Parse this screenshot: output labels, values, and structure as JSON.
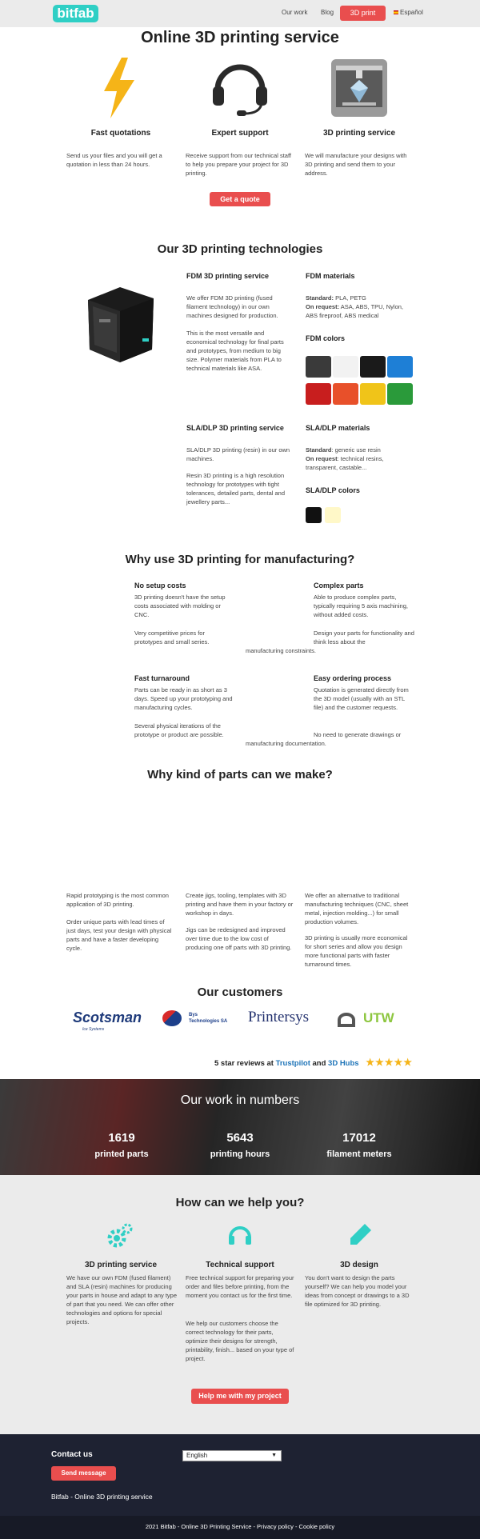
{
  "header": {
    "logo": "bitfab",
    "nav": [
      "Our work",
      "Blog"
    ],
    "cta": "3D print",
    "language": "Español"
  },
  "hero": {
    "title": "Online 3D printing service",
    "features": [
      {
        "title": "Fast quotations",
        "text": "Send us your files and you will get a quotation in less than 24 hours."
      },
      {
        "title": "Expert support",
        "text": "Receive support from our technical staff to help you prepare your project for 3D printing."
      },
      {
        "title": "3D printing service",
        "text": "We will manufacture your designs with 3D printing and send them to your address."
      }
    ],
    "cta": "Get a quote"
  },
  "tech": {
    "title": "Our 3D printing technologies",
    "fdm": {
      "title": "FDM 3D printing service",
      "p1": "We offer FDM 3D printing (fused filament technology) in our own machines designed for production.",
      "p2": "This is the most versatile and economical technology for final parts and prototypes, from medium to big size. Polymer materials from PLA to technical materials like ASA.",
      "materials_title": "FDM materials",
      "standard_label": "Standard:",
      "standard": "PLA, PETG",
      "request_label": "On request:",
      "request": "ASA, ABS, TPU, Nylon, ABS fireproof, ABS medical",
      "colors_title": "FDM colors",
      "colors": [
        "#3a3a3a",
        "#f2f2f2",
        "#1a1a1a",
        "#1e7fd6",
        "#c81e1e",
        "#e8502a",
        "#f0c419",
        "#2a9a3a"
      ]
    },
    "sla": {
      "title": "SLA/DLP 3D printing service",
      "p1": "SLA/DLP 3D printing (resin) in our own machines.",
      "p2": "Resin 3D printing is a high resolution technology for prototypes with tight tolerances, detailed parts, dental and jewellery parts...",
      "materials_title": "SLA/DLP materials",
      "standard_label": "Standard",
      "standard": ": generic use resin",
      "request_label": "On request",
      "request": ": technical resins, transparent, castable...",
      "colors_title": "SLA/DLP colors",
      "colors": [
        "#111111",
        "#fff8c8"
      ]
    }
  },
  "why": {
    "title": "Why use 3D printing for manufacturing?",
    "items": [
      {
        "title": "No setup costs",
        "p1": "3D printing doesn't have the setup costs associated with molding or CNC.",
        "p2": "Very competitive prices for prototypes and small series."
      },
      {
        "title": "Complex parts",
        "p1": "Able to produce complex parts, typically requiring 5 axis machining, without added costs.",
        "p2": "Design your parts for functionality and think less about the",
        "p3": "manufacturing constraints."
      },
      {
        "title": "Fast turnaround",
        "p1": "Parts can be ready in as short as 3 days. Speed up your prototyping and manufacturing cycles.",
        "p2": "Several physical iterations of the prototype or product are possible."
      },
      {
        "title": "Easy ordering process",
        "p1": "Quotation is generated directly from the 3D model (usually with an STL file) and the customer requests.",
        "p2": "No need to generate drawings or",
        "p3": "manufacturing documentation."
      }
    ]
  },
  "parts": {
    "title": "Why kind of parts can we make?",
    "cols": [
      {
        "p1": "Rapid prototyping is the most common application of 3D printing.",
        "p2": "Order unique parts with lead times of just days, test your design with physical parts and have a faster developing cycle."
      },
      {
        "p1": "Create jigs, tooling, templates with 3D printing and have them in your factory or workshop in days.",
        "p2": "Jigs can be redesigned and improved over time due to the low cost of producing one off parts with 3D printing."
      },
      {
        "p1": "We offer an alternative to traditional manufacturing techniques (CNC, sheet metal, injection molding...) for small production volumes.",
        "p2": "3D printing is usually more economical for short series and allow you design more functional parts with faster turnaround times."
      }
    ]
  },
  "customers": {
    "title": "Our customers",
    "logos": [
      "Scotsman",
      "Ice Systems",
      "Bys",
      "Technologies SA",
      "Printersys",
      "UTW"
    ],
    "reviews_prefix": "5 star reviews at",
    "trustpilot": "Trustpilot",
    "and": "and",
    "hubs": "3D Hubs",
    "stars": "★★★★★"
  },
  "numbers": {
    "title": "Our work in numbers",
    "items": [
      {
        "value": "1619",
        "label": "printed parts"
      },
      {
        "value": "5643",
        "label": "printing hours"
      },
      {
        "value": "17012",
        "label": "filament meters"
      }
    ]
  },
  "help": {
    "title": "How can we help you?",
    "items": [
      {
        "title": "3D printing service",
        "p1": "We have our own FDM (fused filament) and SLA (resin) machines for producing your parts in house and adapt to any type of part that you need. We can offer other technologies and options for special projects."
      },
      {
        "title": "Technical support",
        "p1": "Free technical support for preparing your order and files before printing, from the moment you contact us for the first time.",
        "p2": "We help our customers choose the correct technology for their parts, optimize their designs for strength, printability, finish... based on your type of project."
      },
      {
        "title": "3D design",
        "p1": "You don't want to design the parts yourself? We can help you model your ideas from concept or drawings to a 3D file optimized for 3D printing."
      }
    ],
    "cta": "Help me with my project"
  },
  "footer": {
    "contact": "Contact us",
    "send": "Send message",
    "company": "Bitfab - Online 3D printing service",
    "language": "English",
    "bottom": "2021 Bitfab - Online 3D Printing Service - Privacy policy - Cookie policy"
  },
  "colors": {
    "accent_red": "#e94e4e",
    "accent_teal": "#2fcfc5",
    "link_blue": "#1e74b8"
  }
}
